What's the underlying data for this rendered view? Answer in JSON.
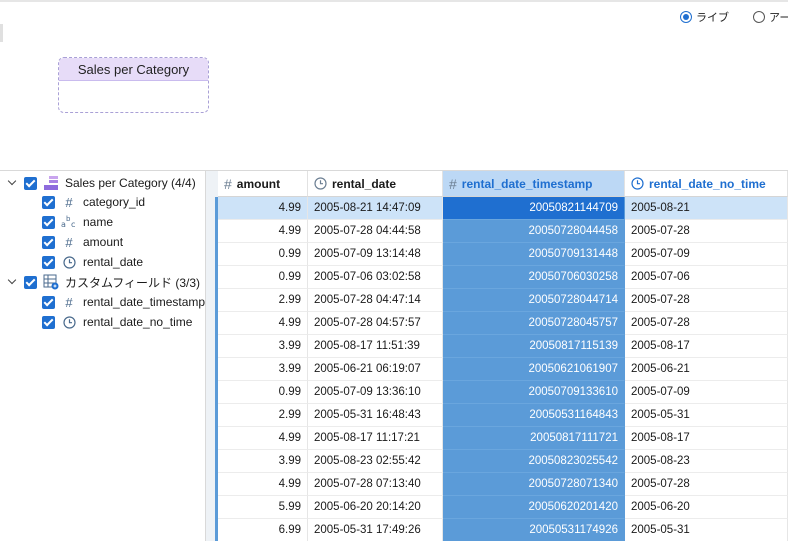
{
  "live_option": {
    "label": "ライブ",
    "selected": true
  },
  "extract_option": {
    "label": "アー",
    "selected": false
  },
  "logical_table": {
    "name": "Sales per Category"
  },
  "tree": {
    "table_node": {
      "label": "Sales per Category (4/4)"
    },
    "fields": [
      {
        "label": "category_id",
        "icon": "number-icon"
      },
      {
        "label": "name",
        "icon": "string-icon"
      },
      {
        "label": "amount",
        "icon": "number-icon"
      },
      {
        "label": "rental_date",
        "icon": "datetime-icon"
      }
    ],
    "custom_node": {
      "label": "カスタムフィールド (3/3)"
    },
    "custom_fields": [
      {
        "label": "rental_date_timestamp",
        "icon": "number-icon"
      },
      {
        "label": "rental_date_no_time",
        "icon": "datetime-icon"
      }
    ]
  },
  "grid": {
    "columns": [
      {
        "label": "amount",
        "icon": "number-icon"
      },
      {
        "label": "rental_date",
        "icon": "datetime-icon"
      },
      {
        "label": "rental_date_timestamp",
        "icon": "number-icon"
      },
      {
        "label": "rental_date_no_time",
        "icon": "datetime-icon"
      }
    ],
    "rows": [
      [
        "4.99",
        "2005-08-21 14:47:09",
        "20050821144709",
        "2005-08-21"
      ],
      [
        "4.99",
        "2005-07-28 04:44:58",
        "20050728044458",
        "2005-07-28"
      ],
      [
        "0.99",
        "2005-07-09 13:14:48",
        "20050709131448",
        "2005-07-09"
      ],
      [
        "0.99",
        "2005-07-06 03:02:58",
        "20050706030258",
        "2005-07-06"
      ],
      [
        "2.99",
        "2005-07-28 04:47:14",
        "20050728044714",
        "2005-07-28"
      ],
      [
        "4.99",
        "2005-07-28 04:57:57",
        "20050728045757",
        "2005-07-28"
      ],
      [
        "3.99",
        "2005-08-17 11:51:39",
        "20050817115139",
        "2005-08-17"
      ],
      [
        "3.99",
        "2005-06-21 06:19:07",
        "20050621061907",
        "2005-06-21"
      ],
      [
        "0.99",
        "2005-07-09 13:36:10",
        "20050709133610",
        "2005-07-09"
      ],
      [
        "2.99",
        "2005-05-31 16:48:43",
        "20050531164843",
        "2005-05-31"
      ],
      [
        "4.99",
        "2005-08-17 11:17:21",
        "20050817111721",
        "2005-08-17"
      ],
      [
        "3.99",
        "2005-08-23 02:55:42",
        "20050823025542",
        "2005-08-23"
      ],
      [
        "4.99",
        "2005-07-28 07:13:40",
        "20050728071340",
        "2005-07-28"
      ],
      [
        "5.99",
        "2005-06-20 20:14:20",
        "20050620201420",
        "2005-06-20"
      ],
      [
        "6.99",
        "2005-05-31 17:49:26",
        "20050531174926",
        "2005-05-31"
      ]
    ]
  },
  "colors": {
    "accent": "#1f6fd0",
    "selected_column": "#5b9bd8",
    "logical_table_header": "#e7dcf8"
  }
}
